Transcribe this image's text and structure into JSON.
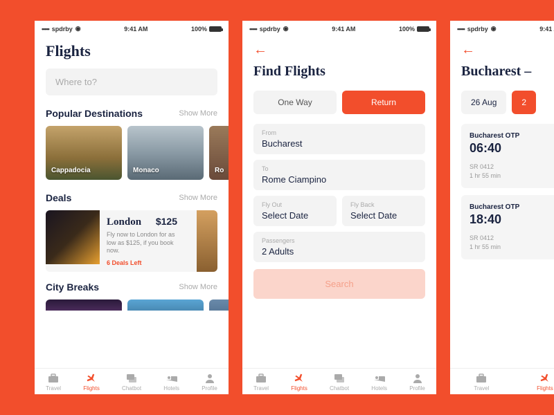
{
  "statusbar": {
    "carrier": "spdrby",
    "time": "9:41 AM",
    "battery": "100%"
  },
  "screen1": {
    "title": "Flights",
    "search_placeholder": "Where to?",
    "popular": {
      "title": "Popular Destinations",
      "show_more": "Show More",
      "items": [
        "Cappadocia",
        "Monaco",
        "Ro"
      ]
    },
    "deals": {
      "title": "Deals",
      "show_more": "Show More",
      "city": "London",
      "price": "$125",
      "desc": "Fly now to London for as low as $125, if you book now.",
      "left": "6 Deals Left"
    },
    "citybreaks": {
      "title": "City Breaks",
      "show_more": "Show More"
    }
  },
  "screen2": {
    "title": "Find Flights",
    "oneway": "One Way",
    "return": "Return",
    "from_label": "From",
    "from_value": "Bucharest",
    "to_label": "To",
    "to_value": "Rome Ciampino",
    "flyout_label": "Fly Out",
    "flyout_value": "Select Date",
    "flyback_label": "Fly Back",
    "flyback_value": "Select Date",
    "pax_label": "Passengers",
    "pax_value": "2 Adults",
    "search": "Search"
  },
  "screen3": {
    "title": "Bucharest –",
    "date1": "26 Aug",
    "date2": "2",
    "f1": {
      "airport": "Bucharest OTP",
      "time": "06:40",
      "code": "SR 0412",
      "dur": "1 hr 55 min"
    },
    "f2": {
      "airport": "Bucharest OTP",
      "time": "18:40",
      "code": "SR 0412",
      "dur": "1 hr 55 min"
    }
  },
  "tabs": [
    "Travel",
    "Flights",
    "Chatbot",
    "Hotels",
    "Profile"
  ]
}
